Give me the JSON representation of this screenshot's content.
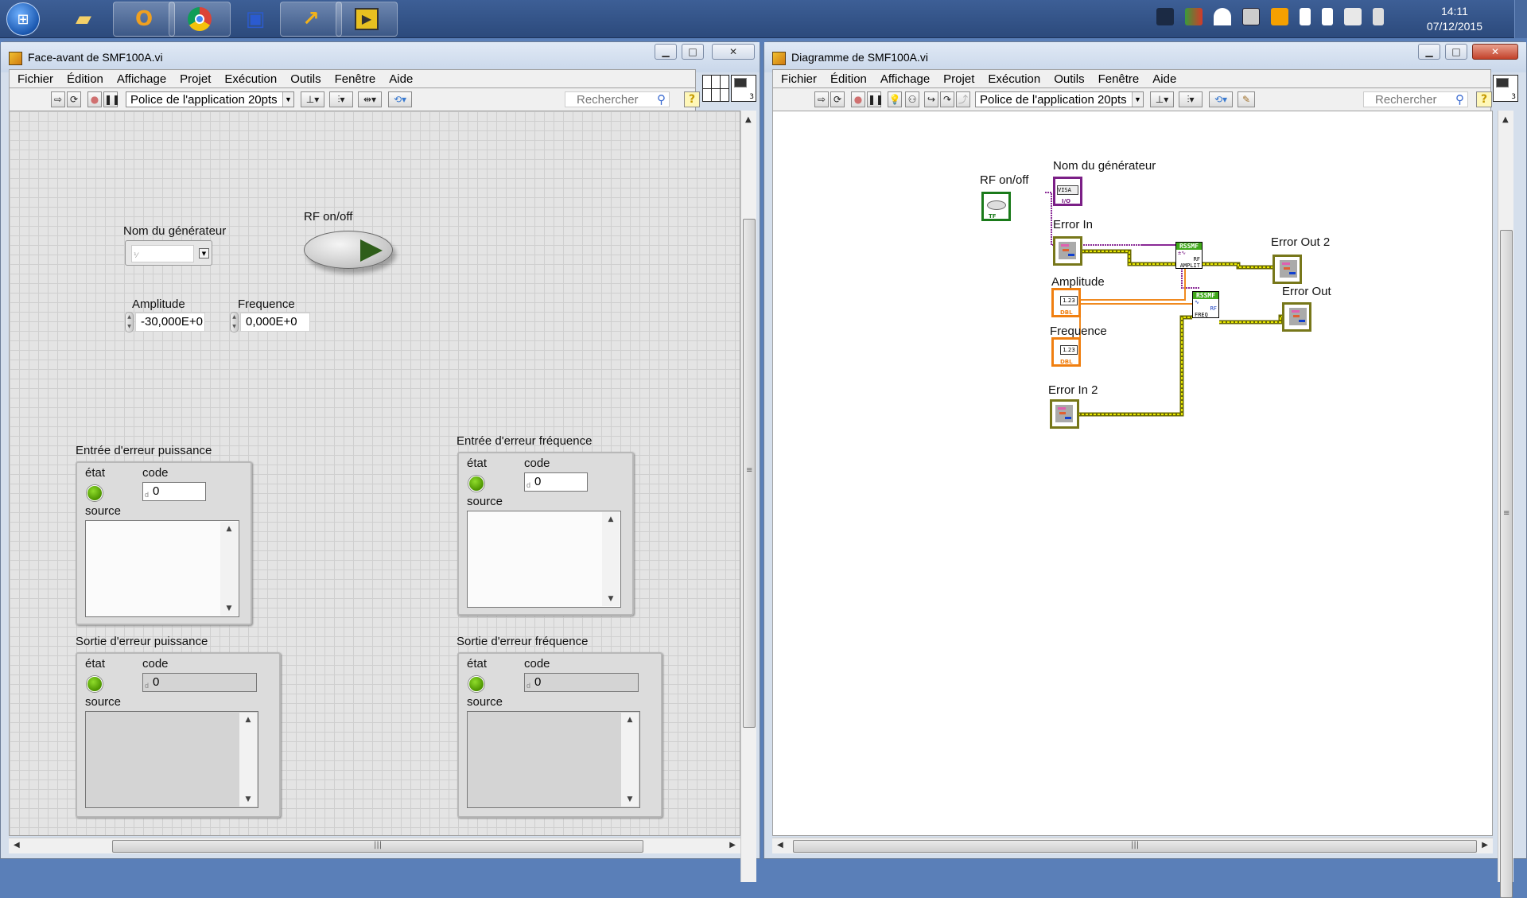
{
  "taskbar": {
    "apps": [
      {
        "name": "explorer",
        "glyph": "📁"
      },
      {
        "name": "outlook",
        "glyph": "✉"
      },
      {
        "name": "chrome",
        "glyph": "◉"
      },
      {
        "name": "system-monitor",
        "glyph": "🖥"
      },
      {
        "name": "app-arrow",
        "glyph": "↗"
      },
      {
        "name": "labview",
        "glyph": "▶"
      }
    ],
    "time": "14:11",
    "date": "07/12/2015"
  },
  "front_panel": {
    "title": "Face-avant de SMF100A.vi",
    "menu": [
      "Fichier",
      "Édition",
      "Affichage",
      "Projet",
      "Exécution",
      "Outils",
      "Fenêtre",
      "Aide"
    ],
    "font_select": "Police de l'application 20pts",
    "search_placeholder": "Rechercher",
    "vi_icon_number": "3",
    "controls": {
      "generator_label": "Nom du générateur",
      "generator_value": "",
      "rf_label": "RF on/off",
      "amplitude_label": "Amplitude",
      "amplitude_value": "-30,000E+0",
      "frequency_label": "Frequence",
      "frequency_value": "0,000E+0"
    },
    "clusters": [
      {
        "label": "Entrée d'erreur puissance",
        "state_label": "état",
        "code_label": "code",
        "code": "0",
        "source_label": "source",
        "source": "",
        "indicator": false
      },
      {
        "label": "Entrée d'erreur fréquence",
        "state_label": "état",
        "code_label": "code",
        "code": "0",
        "source_label": "source",
        "source": "",
        "indicator": false
      },
      {
        "label": "Sortie d'erreur puissance",
        "state_label": "état",
        "code_label": "code",
        "code": "0",
        "source_label": "source",
        "source": "",
        "indicator": true
      },
      {
        "label": "Sortie d'erreur fréquence",
        "state_label": "état",
        "code_label": "code",
        "code": "0",
        "source_label": "source",
        "source": "",
        "indicator": true
      }
    ]
  },
  "block_diagram": {
    "title": "Diagramme de SMF100A.vi",
    "menu": [
      "Fichier",
      "Édition",
      "Affichage",
      "Projet",
      "Exécution",
      "Outils",
      "Fenêtre",
      "Aide"
    ],
    "font_select": "Police de l'application 20pts",
    "search_placeholder": "Rechercher",
    "vi_icon_number": "3",
    "terminals": {
      "rf": {
        "label": "RF on/off",
        "type": "TF",
        "color": "#1a7a1a"
      },
      "generator": {
        "label": "Nom du générateur",
        "type": "I/O",
        "inner": "VISA",
        "color": "#7b1f86"
      },
      "error_in": {
        "label": "Error In",
        "color": "#77771a"
      },
      "amplitude": {
        "label": "Amplitude",
        "type": "DBL",
        "inner": "1.23",
        "color": "#f07f10"
      },
      "frequency": {
        "label": "Frequence",
        "type": "DBL",
        "inner": "1.23",
        "color": "#f07f10"
      },
      "error_in2": {
        "label": "Error In 2",
        "color": "#77771a"
      },
      "error_out2": {
        "label": "Error Out 2",
        "color": "#77771a"
      },
      "error_out": {
        "label": "Error Out",
        "color": "#77771a"
      }
    },
    "subvis": [
      {
        "name": "RSSMF",
        "line1": "RF",
        "line2": "AMPLIT"
      },
      {
        "name": "RSSMF",
        "line1": "RF",
        "line2": "FREQ"
      }
    ],
    "wire_colors": {
      "error": "#c8c800",
      "visa": "#8a2a96",
      "dbl": "#f08a20"
    }
  }
}
